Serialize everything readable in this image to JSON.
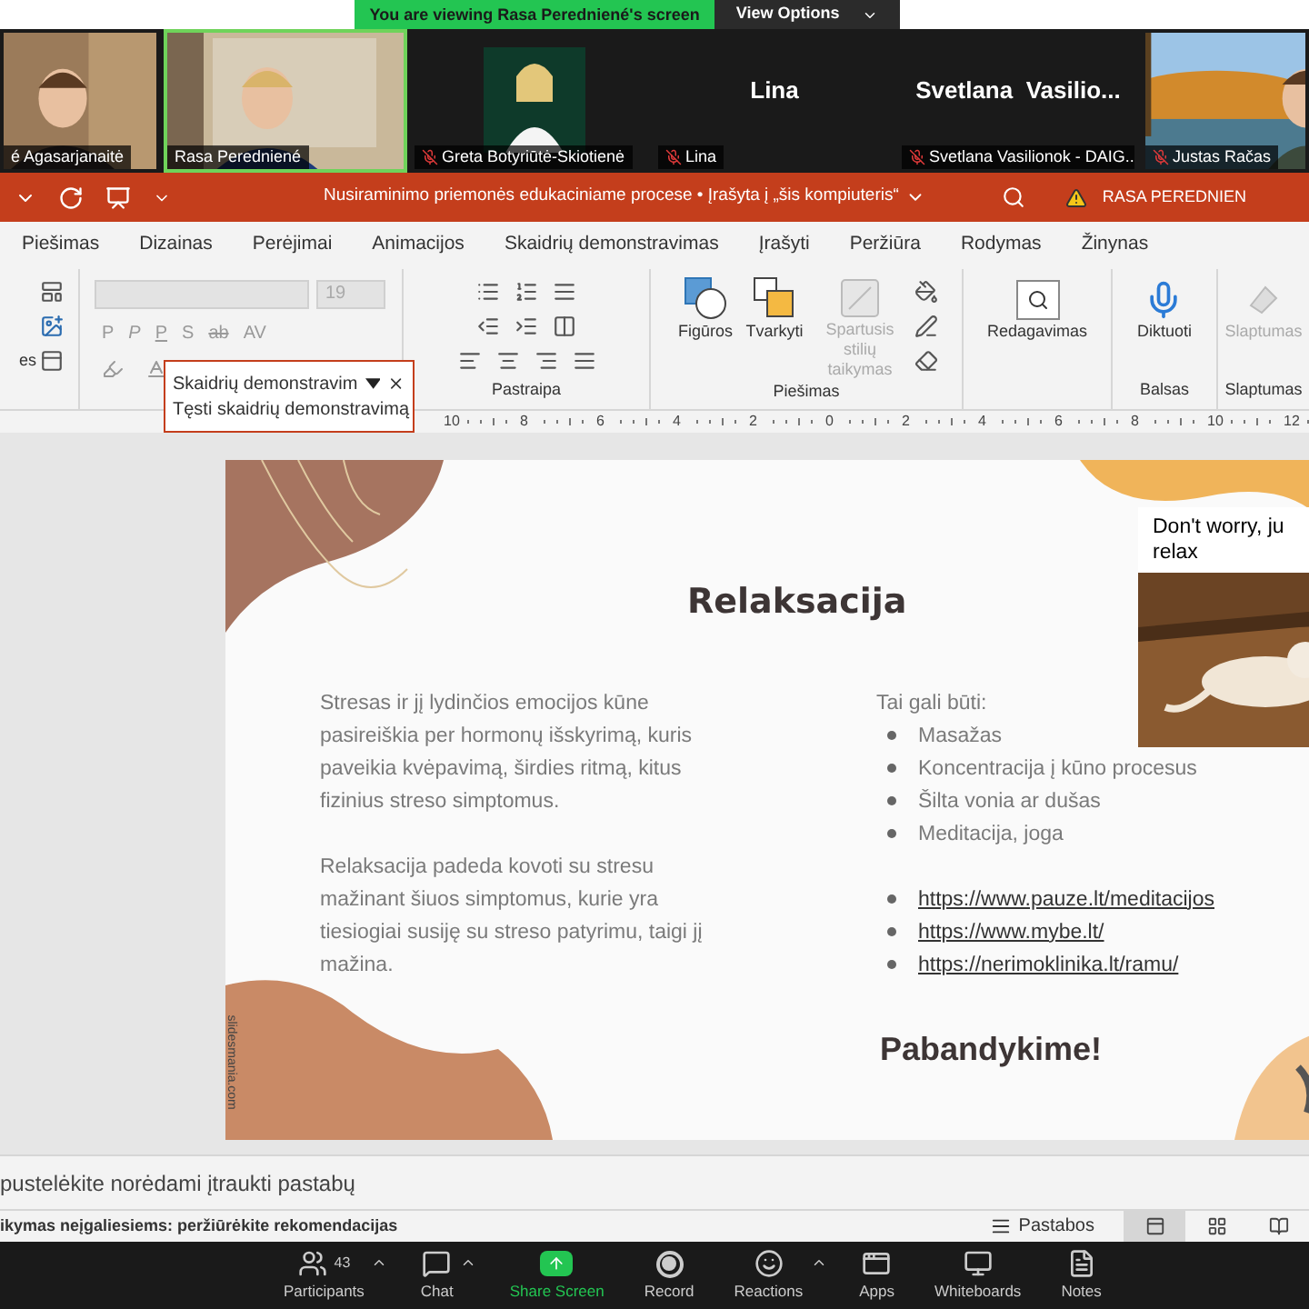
{
  "share_banner": {
    "text": "You are viewing Rasa Peredniené's screen",
    "button": "View Options"
  },
  "video_tiles": [
    {
      "name": "é Agasarjanaitė",
      "kind": "video",
      "muted": false,
      "highlighted": false
    },
    {
      "name": "Rasa Peredniené",
      "kind": "video",
      "muted": false,
      "highlighted": true
    },
    {
      "name": "Greta Botyriūtė-Skiotienė",
      "muted": true,
      "highlighted": false
    },
    {
      "name": "Lina",
      "kind": "avatar",
      "big_name": "Lina",
      "muted": true,
      "highlighted": false
    },
    {
      "name": "Svetlana Vasilionok - DAIG...",
      "kind": "avatar",
      "big_name": "Svetlana  Vasilio...",
      "muted": true,
      "highlighted": false
    },
    {
      "name": "Justas Račas",
      "kind": "video",
      "muted": true,
      "highlighted": false
    }
  ],
  "window": {
    "title": "Nusiraminimo priemonės edukaciniame procese • Įrašyta į „šis kompiuteris“",
    "user": "RASA PEREDNIEN"
  },
  "ribbon_tabs": [
    "Piešimas",
    "Dizainas",
    "Perėjimai",
    "Animacijos",
    "Skaidrių demonstravimas",
    "Įrašyti",
    "Peržiūra",
    "Rodymas",
    "Žinynas"
  ],
  "ribbon": {
    "left_cut_label": "es",
    "font_size": "19",
    "format_buttons": [
      "P",
      "P",
      "P",
      "S",
      "ab",
      "AV"
    ],
    "paragraph_label": "Pastraipa",
    "drawing": {
      "buttons": [
        "Figūros",
        "Tvarkyti"
      ],
      "disabled_button": "Spartusis stilių taikymas",
      "label": "Piešimas"
    },
    "editing": "Redagavimas",
    "voice": {
      "button": "Diktuoti",
      "label": "Balsas"
    },
    "sensitivity": {
      "button": "Slaptumas",
      "label": "Slaptumas"
    }
  },
  "popup": {
    "title": "Skaidrių demonstravim",
    "action": "Tęsti skaidrių demonstravimą"
  },
  "ruler": [
    "10",
    "8",
    "6",
    "4",
    "2",
    "0",
    "2",
    "4",
    "6",
    "8",
    "10",
    "12"
  ],
  "slide": {
    "title": "Relaksacija",
    "paragraphs": [
      "Stresas ir jį lydinčios emocijos kūne pasireiškia per hormonų išskyrimą, kuris paveikia kvėpavimą, širdies ritmą, kitus fizinius streso simptomus.",
      "Relaksacija padeda kovoti su stresu mažinant šiuos simptomus, kurie yra tiesiogiai susiję su streso patyrimu, taigi jį mažina."
    ],
    "list_title": "Tai gali būti:",
    "bullets": [
      "Masažas",
      "Koncentracija į kūno procesus",
      "Šilta vonia ar dušas",
      "Meditacija, joga"
    ],
    "links": [
      "https://www.pauze.lt/meditacijos",
      "https://www.mybe.lt/",
      "https://nerimoklinika.lt/ramu/"
    ],
    "call_to_action": "Pabandykime!",
    "image_caption": [
      "Don't worry, ju",
      "relax"
    ],
    "credit": "slidesmania.com"
  },
  "notes_placeholder": "pustelėkite norėdami įtraukti pastabų",
  "status_bar": {
    "text": "ikymas neįgaliesiems: peržiūrėkite rekomendacijas",
    "notes_button": "Pastabos",
    "views": [
      {
        "kind": "normal",
        "selected": true
      },
      {
        "kind": "sorter",
        "selected": false
      },
      {
        "kind": "reading",
        "selected": false
      }
    ]
  },
  "meeting_toolbar": [
    {
      "kind": "participants",
      "label": "Participants",
      "count": "43",
      "caret": true
    },
    {
      "kind": "chat",
      "label": "Chat",
      "caret": true
    },
    {
      "kind": "share",
      "label": "Share Screen",
      "caret": false
    },
    {
      "kind": "record",
      "label": "Record",
      "caret": false
    },
    {
      "kind": "reactions",
      "label": "Reactions",
      "caret": true
    },
    {
      "kind": "apps",
      "label": "Apps",
      "caret": false
    },
    {
      "kind": "whiteboards",
      "label": "Whiteboards",
      "caret": false
    },
    {
      "kind": "notes",
      "label": "Notes",
      "caret": false
    }
  ]
}
